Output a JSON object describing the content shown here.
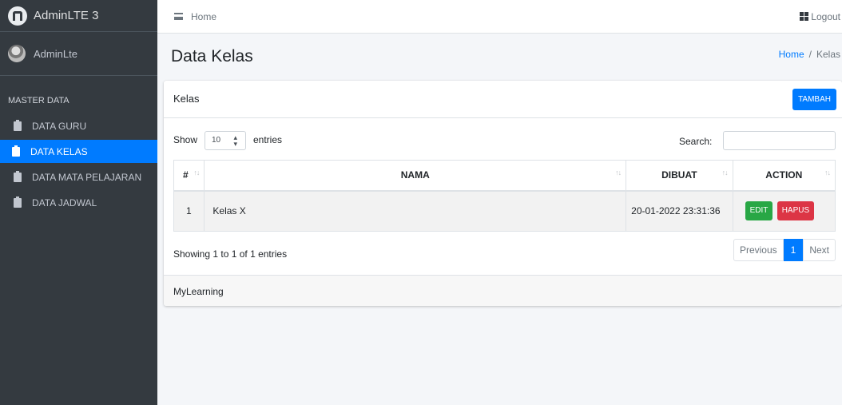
{
  "brand": {
    "title": "AdminLTE 3"
  },
  "user": {
    "name": "AdminLte"
  },
  "sidebar": {
    "header": "MASTER DATA",
    "items": [
      {
        "label": "DATA GURU",
        "active": false
      },
      {
        "label": "DATA KELAS",
        "active": true
      },
      {
        "label": "DATA MATA PELAJARAN",
        "active": false
      },
      {
        "label": "DATA JADWAL",
        "active": false
      }
    ]
  },
  "navbar": {
    "home": "Home",
    "logout": "Logout"
  },
  "content_header": {
    "title": "Data Kelas",
    "breadcrumb": {
      "home": "Home",
      "separator": "/",
      "current": "Kelas"
    }
  },
  "card": {
    "title": "Kelas",
    "add_button": "TAMBAH",
    "footer": "MyLearning"
  },
  "datatable": {
    "show_label": "Show",
    "entries_value": "10",
    "entries_label": "entries",
    "search_label": "Search:",
    "search_value": "",
    "columns": [
      "#",
      "NAMA",
      "DIBUAT",
      "ACTION"
    ],
    "rows": [
      {
        "no": "1",
        "nama": "Kelas X",
        "dibuat": "20-01-2022 23:31:36",
        "edit": "EDIT",
        "hapus": "HAPUS"
      }
    ],
    "info": "Showing 1 to 1 of 1 entries",
    "pagination": {
      "previous": "Previous",
      "current": "1",
      "next": "Next"
    }
  },
  "colors": {
    "primary": "#007bff",
    "success": "#28a745",
    "danger": "#dc3545",
    "sidebar_bg": "#343a40"
  }
}
